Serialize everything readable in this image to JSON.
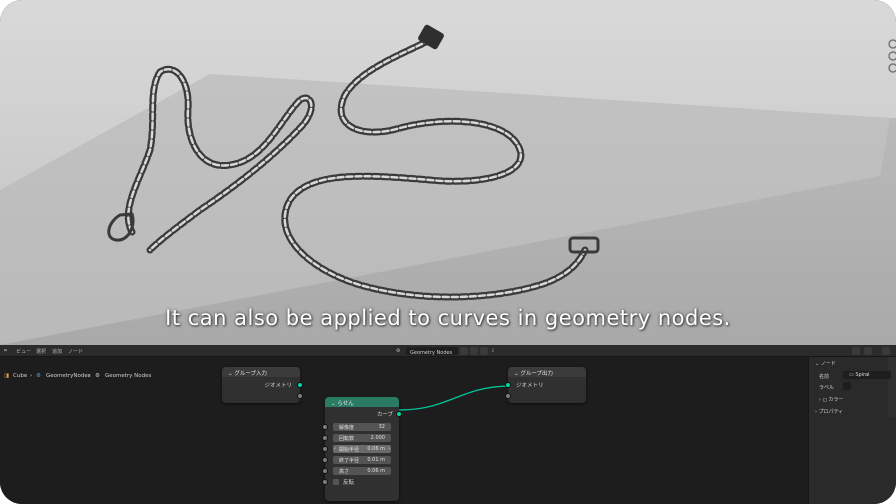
{
  "subtitle": "It can also be applied to curves in geometry nodes.",
  "editor": {
    "header": {
      "menus": [
        "ビュー",
        "選択",
        "追加",
        "ノード"
      ],
      "node_tree_name": "Geometry Nodes"
    },
    "breadcrumb": [
      "Cube",
      "GeometryNodes",
      "Geometry Nodes"
    ],
    "nodes": {
      "group_input": {
        "title": "グループ入力",
        "output": "ジオメトリ"
      },
      "spiral": {
        "title": "らせん",
        "output": "カーブ",
        "fields": [
          {
            "label": "解像度",
            "value": "32"
          },
          {
            "label": "回転数",
            "value": "2.000"
          },
          {
            "label": "開始半径",
            "value": "0.06 m"
          },
          {
            "label": "終了半径",
            "value": "0.01 m"
          },
          {
            "label": "高さ",
            "value": "0.06 m"
          }
        ],
        "checkbox": "反転"
      },
      "group_output": {
        "title": "グループ出力",
        "input": "ジオメトリ"
      }
    },
    "sidebar": {
      "panel_title": "ノード",
      "name_label": "名前",
      "name_value": "Spiral",
      "label_label": "ラベル",
      "color_label": "カラー",
      "properties_label": "プロパティ"
    }
  },
  "colors": {
    "node_header_group": "#3b3b3b",
    "node_header_spiral": "#2b7a62",
    "socket_geometry": "#00d6a3",
    "link": "#00c69a"
  }
}
